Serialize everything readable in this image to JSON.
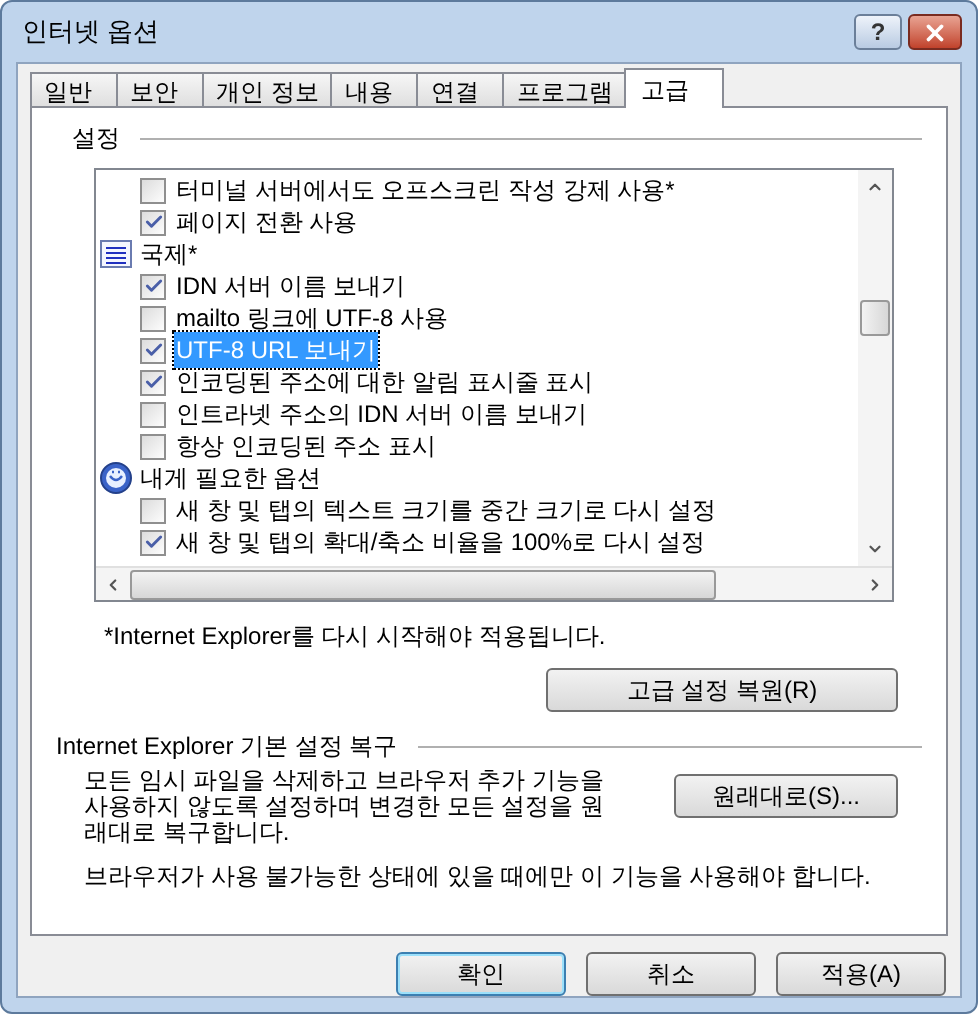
{
  "window": {
    "title": "인터넷 옵션",
    "help": "?"
  },
  "tabs": [
    {
      "label": "일반",
      "selected": false
    },
    {
      "label": "보안",
      "selected": false
    },
    {
      "label": "개인 정보",
      "selected": false
    },
    {
      "label": "내용",
      "selected": false
    },
    {
      "label": "연결",
      "selected": false
    },
    {
      "label": "프로그램",
      "selected": false
    },
    {
      "label": "고급",
      "selected": true
    }
  ],
  "settings": {
    "title": "설정",
    "items": [
      {
        "kind": "check",
        "label": "터미널 서버에서도 오프스크린 작성 강제 사용*",
        "checked": false,
        "selected": false
      },
      {
        "kind": "check",
        "label": "페이지 전환 사용",
        "checked": true,
        "selected": false
      },
      {
        "kind": "list-group",
        "label": "국제*",
        "selected": false
      },
      {
        "kind": "check",
        "label": "IDN 서버 이름 보내기",
        "checked": true,
        "selected": false
      },
      {
        "kind": "check",
        "label": "mailto 링크에 UTF-8 사용",
        "checked": false,
        "selected": false
      },
      {
        "kind": "check",
        "label": "UTF-8 URL 보내기",
        "checked": true,
        "selected": true
      },
      {
        "kind": "check",
        "label": "인코딩된 주소에 대한 알림 표시줄 표시",
        "checked": true,
        "selected": false
      },
      {
        "kind": "check",
        "label": "인트라넷 주소의 IDN 서버 이름 보내기",
        "checked": false,
        "selected": false
      },
      {
        "kind": "check",
        "label": "항상 인코딩된 주소 표시",
        "checked": false,
        "selected": false
      },
      {
        "kind": "globe-group",
        "label": "내게 필요한 옵션",
        "selected": false
      },
      {
        "kind": "check",
        "label": "새 창 및 탭의 텍스트 크기를 중간 크기로 다시 설정",
        "checked": false,
        "selected": false
      },
      {
        "kind": "check",
        "label": "새 창 및 탭의 확대/축소 비율을 100%로 다시 설정",
        "checked": true,
        "selected": false
      }
    ],
    "note": "*Internet Explorer를 다시 시작해야 적용됩니다.",
    "restore_button": "고급 설정 복원(R)"
  },
  "reset": {
    "title": "Internet Explorer 기본 설정 복구",
    "description": "모든 임시 파일을 삭제하고 브라우저 추가 기능을 사용하지 않도록 설정하며 변경한 모든 설정을 원래대로 복구합니다.",
    "button": "원래대로(S)...",
    "warning": "브라우저가 사용 불가능한 상태에 있을 때에만 이 기능을 사용해야 합니다."
  },
  "buttons": [
    {
      "label": "확인",
      "default": true
    },
    {
      "label": "취소",
      "default": false
    },
    {
      "label": "적용(A)",
      "default": false
    }
  ]
}
